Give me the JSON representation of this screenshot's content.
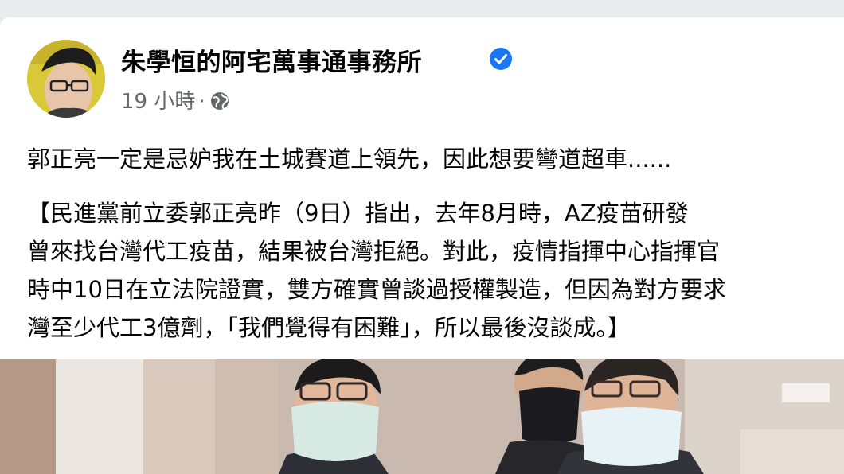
{
  "post": {
    "author": "朱學恒的阿宅萬事通事務所",
    "time": "19 小時",
    "separator": "·",
    "audience_icon": "globe-icon",
    "verified_icon": "verified-badge-icon",
    "text": "郭正亮一定是忌妒我在土城賽道上領先，因此想要彎道超車......",
    "quote_lines": [
      "【民進黨前立委郭正亮昨（9日）指出，去年8月時，AZ疫苗研發",
      "曾來找台灣代工疫苗，結果被台灣拒絕。對此，疫情指揮中心指揮官",
      "時中10日在立法院證實，雙方確實曾談過授權製造，但因為對方要求",
      "灣至少代工3億劑，「我們覺得有困難」，所以最後沒談成。】"
    ]
  },
  "colors": {
    "accent": "#1877f2",
    "meta_text": "#65676b",
    "body_text": "#050505"
  }
}
